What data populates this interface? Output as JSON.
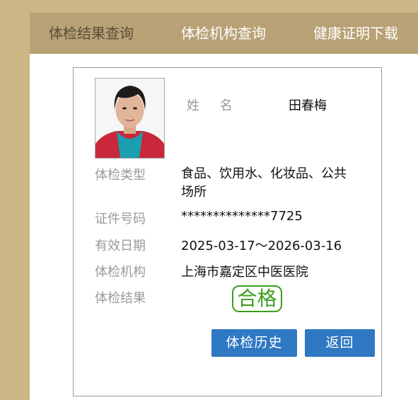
{
  "nav": {
    "items": [
      {
        "label": "体检结果查询"
      },
      {
        "label": "体检机构查询"
      },
      {
        "label": "健康证明下载"
      }
    ]
  },
  "card": {
    "name_label": "姓名",
    "name_value": "田春梅",
    "fields": [
      {
        "label": "体检类型",
        "value": "食品、饮用水、化妆品、公共场所"
      },
      {
        "label": "证件号码",
        "value": "**************7725"
      },
      {
        "label": "有效日期",
        "value": "2025-03-17～2026-03-16"
      },
      {
        "label": "体检机构",
        "value": "上海市嘉定区中医医院"
      },
      {
        "label": "体检结果",
        "value": "合格"
      }
    ],
    "buttons": {
      "history": "体检历史",
      "back": "返回"
    }
  },
  "colors": {
    "nav_bg": "#b8a175",
    "side_bg": "#cdb586",
    "button_bg": "#2f78c4",
    "pass_green": "#3a9e1a"
  },
  "icons": {
    "photo": "person-photo"
  }
}
